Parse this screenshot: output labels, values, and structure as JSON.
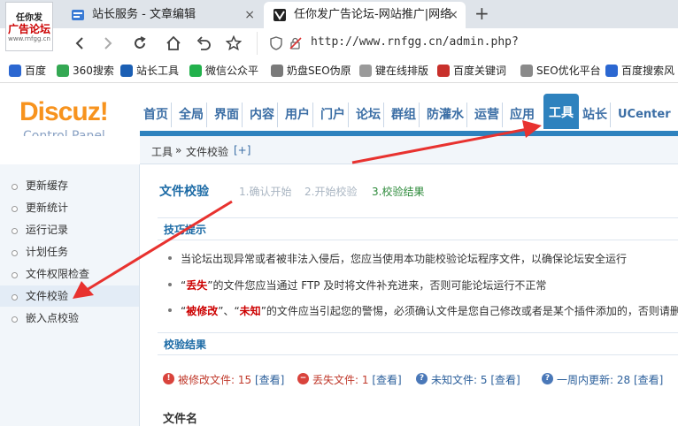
{
  "browser": {
    "logo": {
      "line1": "任你发",
      "line2": "广告论坛",
      "line3": "www.rnfgg.cn"
    },
    "tabs": [
      {
        "label": "站长服务 - 文章编辑",
        "active": false
      },
      {
        "label": "任你发广告论坛-网站推广|网络",
        "active": true
      }
    ],
    "close_glyph": "×",
    "new_tab_glyph": "+",
    "url": "http://www.rnfgg.cn/admin.php?",
    "bookmarks": [
      {
        "label": "百度",
        "color": "#2b67d1"
      },
      {
        "label": "360搜索",
        "color": "#34a853"
      },
      {
        "label": "站长工具",
        "color": "#1b5fb4"
      },
      {
        "label": "微信公众平",
        "color": "#22b14c"
      },
      {
        "label": "奶盘SEO伪原",
        "color": "#7a7a7a"
      },
      {
        "label": "键在线排版",
        "color": "#9a9a9a"
      },
      {
        "label": "百度关键词",
        "color": "#c8302b"
      },
      {
        "label": "SEO优化平台",
        "color": "#8a8a8a"
      },
      {
        "label": "百度搜索风",
        "color": "#2b67d1"
      }
    ]
  },
  "discuz": {
    "brand": "Discuz!",
    "subtitle": "Control Panel",
    "nav": [
      "首页",
      "全局",
      "界面",
      "内容",
      "用户",
      "门户",
      "论坛",
      "群组",
      "防灌水",
      "运营",
      "应用",
      "工具",
      "站长",
      "UCenter"
    ],
    "active_nav": "工具",
    "breadcrumb": {
      "root": "工具",
      "sep": "»",
      "current": "文件校验",
      "add": "[+]"
    },
    "sidebar": [
      {
        "label": "更新缓存",
        "active": false
      },
      {
        "label": "更新统计",
        "active": false
      },
      {
        "label": "运行记录",
        "active": false
      },
      {
        "label": "计划任务",
        "active": false
      },
      {
        "label": "文件权限检查",
        "active": false
      },
      {
        "label": "文件校验",
        "active": true
      },
      {
        "label": "嵌入点校验",
        "active": false
      }
    ]
  },
  "main": {
    "title": "文件校验",
    "steps": [
      "1.确认开始",
      "2.开始校验",
      "3.校验结果"
    ],
    "tips_title": "技巧提示",
    "tips": {
      "t1": "当论坛出现异常或者被非法入侵后，您应当使用本功能校验论坛程序文件，以确保论坛安全运行",
      "t2_q1": "“",
      "t2_red": "丢失",
      "t2_rest": "”的文件您应当通过 FTP 及时将文件补充进来，否则可能论坛运行不正常",
      "t3_q1": "“",
      "t3_red1": "被修改",
      "t3_mid": "”、“",
      "t3_red2": "未知",
      "t3_rest": "”的文件应当引起您的警惕，必须确认文件是您自己修改或者是某个插件添加的，否则请删除"
    },
    "results_title": "校验结果",
    "results": {
      "modified_label": "被修改文件:",
      "modified_count": "15",
      "modified_link": "[查看]",
      "lost_label": "丢失文件:",
      "lost_count": "1",
      "lost_link": "[查看]",
      "unknown_label": "未知文件:",
      "unknown_count": "5",
      "unknown_link": "[查看]",
      "week_label": "一周内更新:",
      "week_count": "28",
      "week_link": "[查看]"
    },
    "file_name_header": "文件名"
  },
  "colors": {
    "nav_active": "#2e82be",
    "annotation_arrow": "#e8322f",
    "brand_orange": "#f7931e"
  }
}
